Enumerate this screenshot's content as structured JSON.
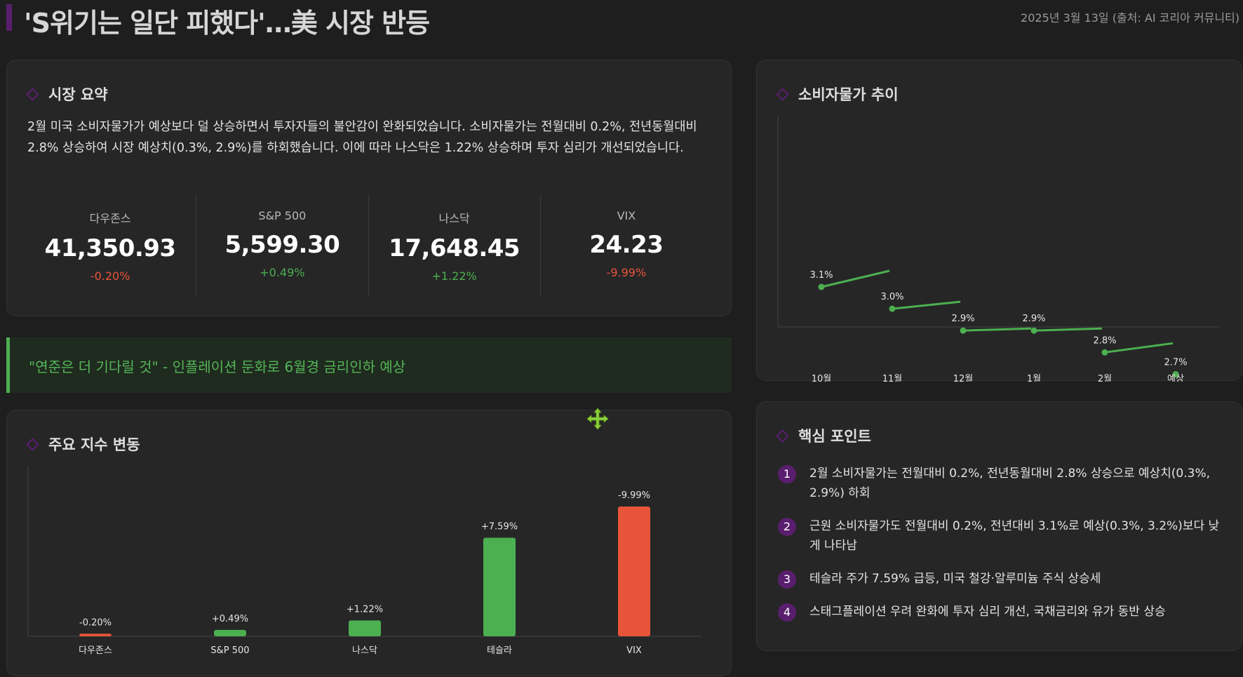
{
  "header": {
    "title": "'S위기는 일단 피했다'…美 시장 반등",
    "meta": "2025년 3월 13일 (출처: AI 코리아 커뮤니티)"
  },
  "summary": {
    "title": "시장 요약",
    "text": "2월 미국 소비자물가가 예상보다 덜 상승하면서 투자자들의 불안감이 완화되었습니다. 소비자물가는 전월대비 0.2%, 전년동월대비 2.8% 상승하여 시장 예상치(0.3%, 2.9%)를 하회했습니다. 이에 따라 나스닥은 1.22% 상승하며 투자 심리가 개선되었습니다.",
    "stats": [
      {
        "label": "다우존스",
        "value": "41,350.93",
        "change": "-0.20%"
      },
      {
        "label": "S&P 500",
        "value": "5,599.30",
        "change": "+0.49%"
      },
      {
        "label": "나스닥",
        "value": "17,648.45",
        "change": "+1.22%"
      },
      {
        "label": "VIX",
        "value": "24.23",
        "change": "-9.99%"
      }
    ]
  },
  "quote": "\"연준은 더 기다릴 것\" - 인플레이션 둔화로 6월경 금리인하 예상",
  "colors": {
    "accent": "#5a1e6e",
    "positive": "#4caf50",
    "negative": "#e8543a",
    "quote_text": "#54b557"
  },
  "indices": {
    "title": "주요 지수 변동"
  },
  "cpi": {
    "title": "소비자물가 추이"
  },
  "points": {
    "title": "핵심 포인트",
    "items": [
      {
        "num": "1",
        "text": "2월 소비자물가는 전월대비 0.2%, 전년동월대비 2.8% 상승으로 예상치(0.3%, 2.9%) 하회"
      },
      {
        "num": "2",
        "text": "근원 소비자물가도 전월대비 0.2%, 전년대비 3.1%로 예상(0.3%, 3.2%)보다 낮게 나타남"
      },
      {
        "num": "3",
        "text": "테슬라 주가 7.59% 급등, 미국 철강·알루미늄 주식 상승세"
      },
      {
        "num": "4",
        "text": "스태그플레이션 우려 완화에 투자 심리 개선, 국채금리와 유가 동반 상승"
      }
    ]
  },
  "move_icon": "move-cursor-icon",
  "chart_data": [
    {
      "type": "bar",
      "title": "주요 지수 변동",
      "categories": [
        "다우존스",
        "S&P 500",
        "나스닥",
        "테슬라",
        "VIX"
      ],
      "values": [
        -0.2,
        0.49,
        1.22,
        7.59,
        -9.99
      ],
      "labels": [
        "-0.20%",
        "+0.49%",
        "+1.22%",
        "+7.59%",
        "-9.99%"
      ],
      "colors": [
        "#e8543a",
        "#4caf50",
        "#4caf50",
        "#4caf50",
        "#e8543a"
      ]
    },
    {
      "type": "line",
      "title": "소비자물가 추이",
      "categories": [
        "10월",
        "11월",
        "12월",
        "1월",
        "2월",
        "예상"
      ],
      "values": [
        3.1,
        3.0,
        2.9,
        2.9,
        2.8,
        2.7
      ],
      "labels": [
        "3.1%",
        "3.0%",
        "2.9%",
        "2.9%",
        "2.8%",
        "2.7%"
      ],
      "color": "#4caf50"
    }
  ]
}
